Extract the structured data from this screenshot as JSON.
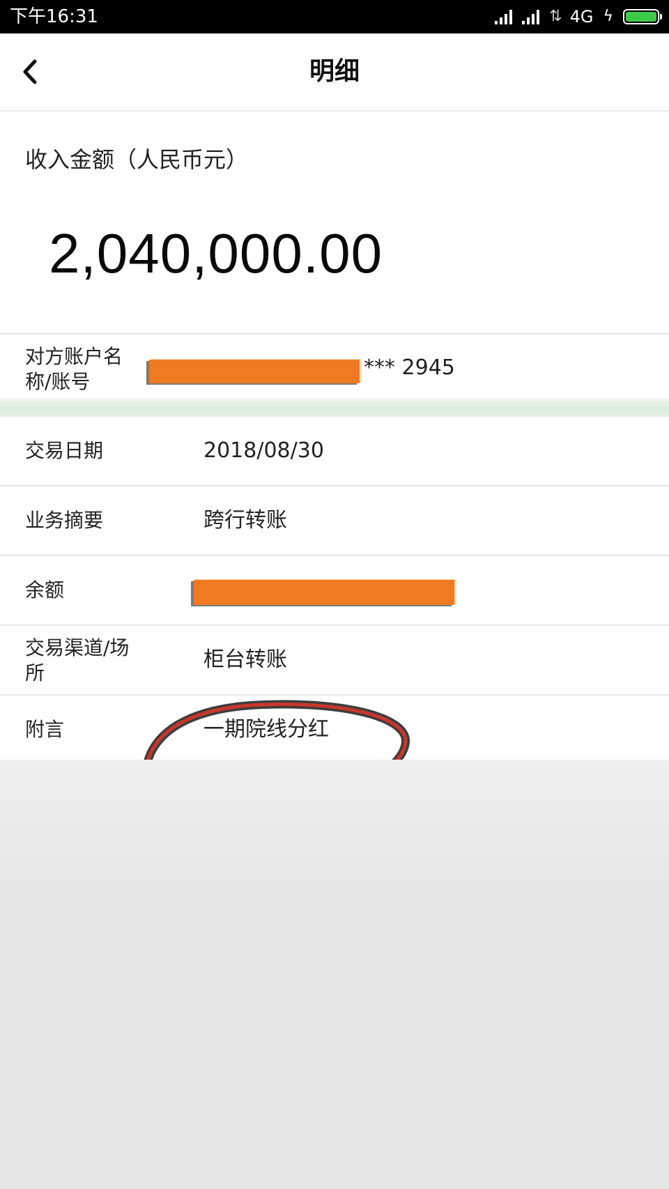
{
  "status_bar": {
    "time": "下午16:31",
    "network": "4G"
  },
  "header": {
    "title": "明细"
  },
  "amount": {
    "label": "收入金额（人民币元）",
    "value": "2,040,000.00"
  },
  "account": {
    "label_line1": "对方账户名",
    "label_line2": "称/账号",
    "value_suffix": "*** 2945"
  },
  "details": {
    "date": {
      "label": "交易日期",
      "value": "2018/08/30"
    },
    "summary": {
      "label": "业务摘要",
      "value": "跨行转账"
    },
    "balance": {
      "label": "余额"
    },
    "channel": {
      "label_line1": "交易渠道/场",
      "label_line2": "所",
      "value": "柜台转账"
    },
    "remark": {
      "label": "附言",
      "value": "一期院线分红"
    }
  },
  "colors": {
    "redaction": "#f07a22",
    "annotation": "#c9362a",
    "battery": "#3ecb4a"
  }
}
